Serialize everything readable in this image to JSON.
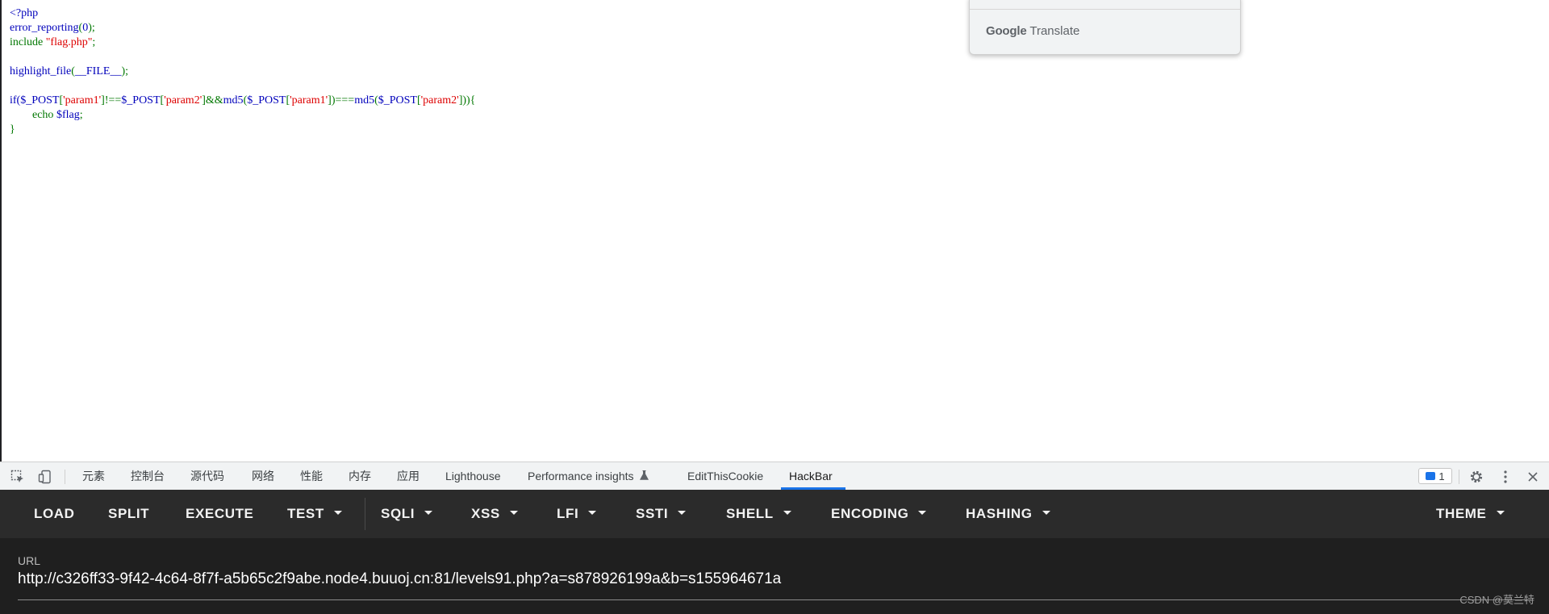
{
  "page": {
    "code": {
      "line1": "<?php",
      "line2_fn": "error_reporting",
      "line2_p1": "(",
      "line2_arg": "0",
      "line2_p2": ");",
      "line3_kw": "include ",
      "line3_str": "\"flag.php\"",
      "line3_end": ";",
      "line5_fn": "highlight_file",
      "line5_p1": "(",
      "line5_arg": "__FILE__",
      "line5_p2": ");",
      "l7": [
        {
          "t": "if(",
          "c": "kw"
        },
        {
          "t": "$_POST",
          "c": "kw"
        },
        {
          "t": "[",
          "c": "gr"
        },
        {
          "t": "'param1'",
          "c": "rd"
        },
        {
          "t": "]!==",
          "c": "gr"
        },
        {
          "t": "$_POST",
          "c": "kw"
        },
        {
          "t": "[",
          "c": "gr"
        },
        {
          "t": "'param2'",
          "c": "rd"
        },
        {
          "t": "]&&",
          "c": "gr"
        },
        {
          "t": "md5",
          "c": "kw"
        },
        {
          "t": "(",
          "c": "gr"
        },
        {
          "t": "$_POST",
          "c": "kw"
        },
        {
          "t": "[",
          "c": "gr"
        },
        {
          "t": "'param1'",
          "c": "rd"
        },
        {
          "t": "])===",
          "c": "gr"
        },
        {
          "t": "md5",
          "c": "kw"
        },
        {
          "t": "(",
          "c": "gr"
        },
        {
          "t": "$_POST",
          "c": "kw"
        },
        {
          "t": "[",
          "c": "gr"
        },
        {
          "t": "'param2'",
          "c": "rd"
        },
        {
          "t": "])){",
          "c": "gr"
        }
      ],
      "line8_kw": "echo ",
      "line8_var": "$flag",
      "line8_end": ";",
      "line9": "}"
    }
  },
  "translate_popup": {
    "brand_google": "Google",
    "brand_translate": " Translate"
  },
  "devtools": {
    "tabs": [
      "元素",
      "控制台",
      "源代码",
      "网络",
      "性能",
      "内存",
      "应用",
      "Lighthouse",
      "Performance insights",
      "EditThisCookie",
      "HackBar"
    ],
    "active_tab": "HackBar",
    "issues_count": "1",
    "icons": [
      "inspect-element-icon",
      "device-toolbar-icon",
      "flask-icon",
      "issues-icon",
      "gear-icon",
      "more-vert-icon",
      "close-icon"
    ]
  },
  "hackbar": {
    "buttons": [
      {
        "label": "LOAD",
        "dropdown": false
      },
      {
        "label": "SPLIT",
        "dropdown": false
      },
      {
        "label": "EXECUTE",
        "dropdown": false
      },
      {
        "label": "TEST",
        "dropdown": true
      },
      {
        "label": "SQLI",
        "dropdown": true
      },
      {
        "label": "XSS",
        "dropdown": true
      },
      {
        "label": "LFI",
        "dropdown": true
      },
      {
        "label": "SSTI",
        "dropdown": true
      },
      {
        "label": "SHELL",
        "dropdown": true
      },
      {
        "label": "ENCODING",
        "dropdown": true
      },
      {
        "label": "HASHING",
        "dropdown": true
      },
      {
        "label": "THEME",
        "dropdown": true
      }
    ],
    "url_label": "URL",
    "url_value": "http://c326ff33-9f42-4c64-8f7f-a5b65c2f9abe.node4.buuoj.cn:81/levels91.php?a=s878926199a&b=s155964671a",
    "watermark": "CSDN @莫兰特"
  },
  "colors": {
    "php_keyword": "#0000BB",
    "php_operator": "#007700",
    "php_string": "#DD0000",
    "hackbar_bg": "#2b2b2b",
    "url_bg": "#1f1f1f",
    "active_tab_underline": "#1a73e8"
  }
}
